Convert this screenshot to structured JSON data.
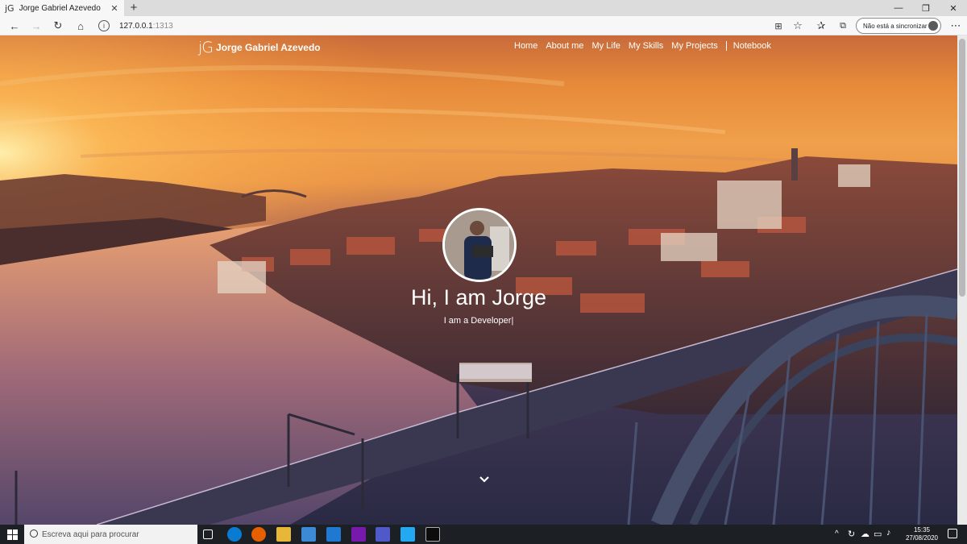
{
  "browser": {
    "tab_title": "Jorge Gabriel Azevedo",
    "tab_favicon": "jG",
    "url_host": "127.0.0.1",
    "url_port": ":1313",
    "sync_label": "Não está a sincronizar"
  },
  "site": {
    "logo": "jG",
    "brand": "Jorge Gabriel Azevedo",
    "nav": [
      "Home",
      "About me",
      "My Life",
      "My Skills",
      "My Projects",
      "Notebook"
    ],
    "greeting": "Hi, I am Jorge",
    "subtitle": "I am a Developer|"
  },
  "taskbar": {
    "search_placeholder": "Escreva aqui para procurar",
    "time": "15:35",
    "date": "27/08/2020"
  },
  "colors": {
    "accent_edge": "#0a7bd3",
    "teams": "#5059c9",
    "onenote": "#7719aa",
    "vscode": "#23a9f2"
  }
}
